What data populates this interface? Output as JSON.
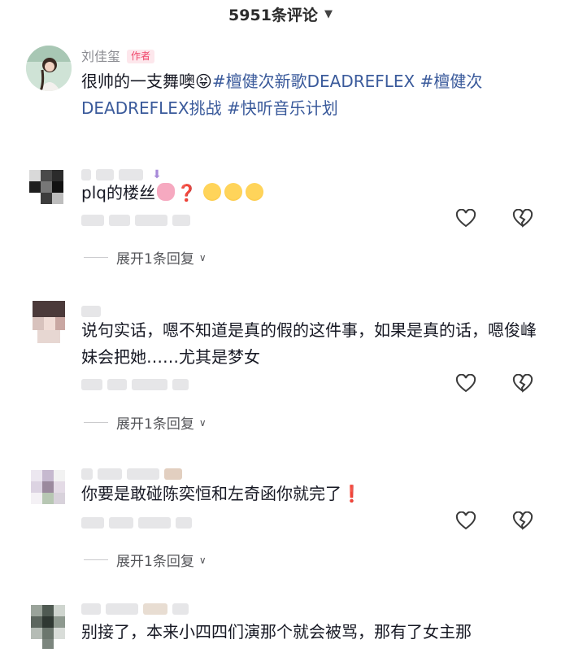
{
  "header": {
    "title": "5951条评论",
    "dropdown_icon": "chevron-down-icon"
  },
  "comments": [
    {
      "name": "刘佳玺",
      "badge": "作者",
      "text_plain": "很帅的一支舞噢",
      "emoji": "😝",
      "tags": [
        "#檀健次新歌DEADREFLEX",
        "#檀健次DEADREFLEX挑战",
        "#快听音乐计划"
      ]
    },
    {
      "text_plain": "plq的楼丝",
      "trail": "❓",
      "expand_label": "展开1条回复"
    },
    {
      "text": "说句实话，嗯不知道是真的假的这件事，如果是真的话，嗯俊峰妹会把她……尤其是梦女",
      "expand_label": "展开1条回复"
    },
    {
      "text_plain": "你要是敢碰陈奕恒和左奇函你就完了",
      "trail": "❗",
      "expand_label": "展开1条回复"
    },
    {
      "text": "别接了，本来小四四们演那个就会被骂，那有了女主那"
    }
  ],
  "icons": {
    "like": "heart-icon",
    "dislike": "broken-heart-icon"
  },
  "colors": {
    "tag": "#3a5a9b",
    "badge_text": "#f0466a",
    "badge_bg": "#fde7ec",
    "muted": "#8a8b91"
  }
}
